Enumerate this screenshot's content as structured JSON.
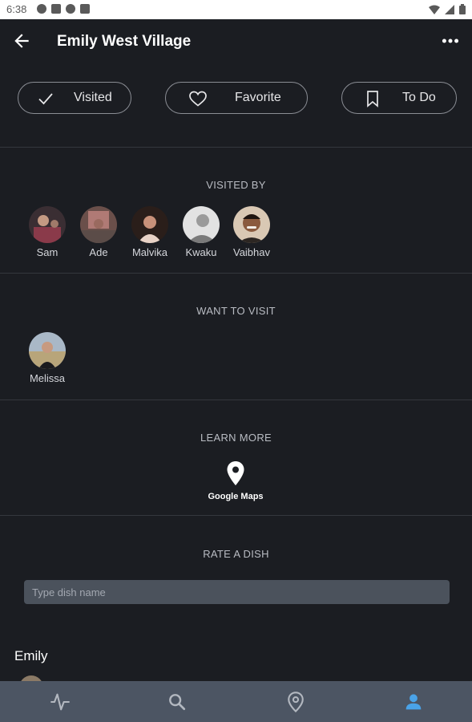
{
  "status_bar": {
    "time": "6:38"
  },
  "header": {
    "title": "Emily West Village"
  },
  "actions": [
    {
      "label": "Visited",
      "icon": "check-icon"
    },
    {
      "label": "Favorite",
      "icon": "heart-icon"
    },
    {
      "label": "To Do",
      "icon": "bookmark-icon"
    }
  ],
  "visited_by": {
    "title": "VISITED BY",
    "people": [
      {
        "name": "Sam"
      },
      {
        "name": "Ade"
      },
      {
        "name": "Malvika"
      },
      {
        "name": "Kwaku"
      },
      {
        "name": "Vaibhav"
      }
    ]
  },
  "want_to_visit": {
    "title": "WANT TO VISIT",
    "people": [
      {
        "name": "Melissa"
      }
    ]
  },
  "learn_more": {
    "title": "LEARN MORE",
    "link_label": "Google Maps"
  },
  "rate_dish": {
    "title": "RATE A DISH",
    "placeholder": "Type dish name",
    "value": ""
  },
  "user": {
    "name": "Emily"
  },
  "colors": {
    "background": "#1b1d22",
    "nav_bar": "#4c5563",
    "active_nav": "#4aa3e8",
    "input_bg": "#4b525c"
  },
  "bottom_nav": [
    {
      "icon": "activity-icon",
      "active": false
    },
    {
      "icon": "search-icon",
      "active": false
    },
    {
      "icon": "map-pin-icon",
      "active": false
    },
    {
      "icon": "profile-icon",
      "active": true
    }
  ]
}
